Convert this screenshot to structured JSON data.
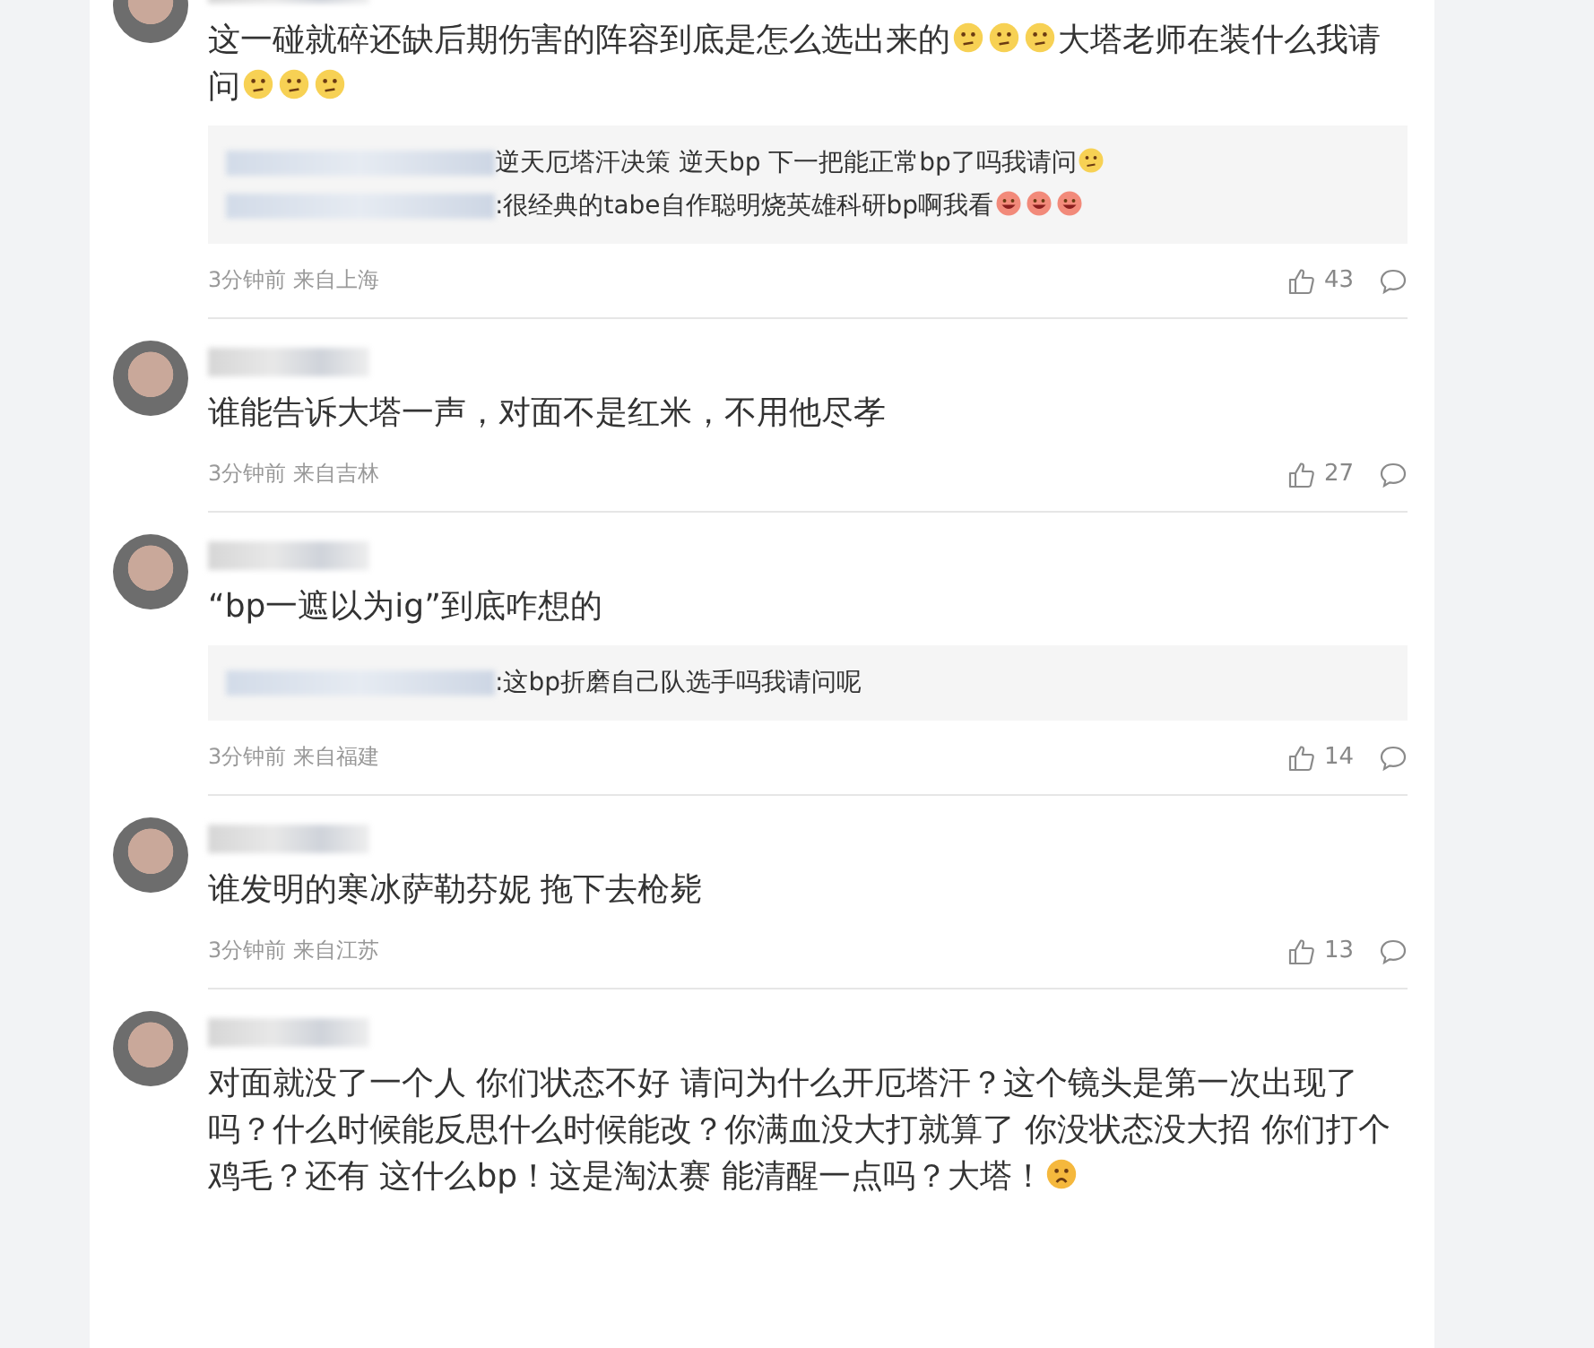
{
  "comments": [
    {
      "text": [
        {
          "kind": "text",
          "text": "这一碰就碎还缺后期伤害的阵容到底是怎么选出来的"
        },
        {
          "kind": "thinking"
        },
        {
          "kind": "thinking"
        },
        {
          "kind": "thinking"
        },
        {
          "kind": "text",
          "text": "大塔老师在装什么我请问"
        },
        {
          "kind": "thinking"
        },
        {
          "kind": "thinking"
        },
        {
          "kind": "thinking"
        }
      ],
      "replies": [
        {
          "parts": [
            {
              "kind": "text",
              "text": "逆天厄塔汗决策 逆天bp 下一把能正常bp了吗我请问"
            },
            {
              "kind": "thinking"
            }
          ]
        },
        {
          "parts": [
            {
              "kind": "text",
              "text": ":很经典的tabe自作聪明烧英雄科研bp啊我看"
            },
            {
              "kind": "grin"
            },
            {
              "kind": "grin"
            },
            {
              "kind": "grin"
            }
          ]
        }
      ],
      "time": "3分钟前",
      "location": "来自上海",
      "likes": "43"
    },
    {
      "text": [
        {
          "kind": "text",
          "text": "谁能告诉大塔一声，对面不是红米，不用他尽孝"
        }
      ],
      "time": "3分钟前",
      "location": "来自吉林",
      "likes": "27"
    },
    {
      "text": [
        {
          "kind": "text",
          "text": "“bp一遮以为ig”到底咋想的"
        }
      ],
      "replies": [
        {
          "parts": [
            {
              "kind": "text",
              "text": ":这bp折磨自己队选手吗我请问呢"
            }
          ]
        }
      ],
      "time": "3分钟前",
      "location": "来自福建",
      "likes": "14"
    },
    {
      "text": [
        {
          "kind": "text",
          "text": "谁发明的寒冰萨勒芬妮 拖下去枪毙"
        }
      ],
      "time": "3分钟前",
      "location": "来自江苏",
      "likes": "13"
    },
    {
      "text": [
        {
          "kind": "text",
          "text": "对面就没了一个人 你们状态不好 请问为什么开厄塔汗？这个镜头是第一次出现了吗？什么时候能反思什么时候能改？你满血没大打就算了 你没状态没大招 你们打个鸡毛？还有 这什么bp！这是淘汰赛 能清醒一点吗？大塔！"
        },
        {
          "kind": "angry"
        }
      ]
    }
  ]
}
